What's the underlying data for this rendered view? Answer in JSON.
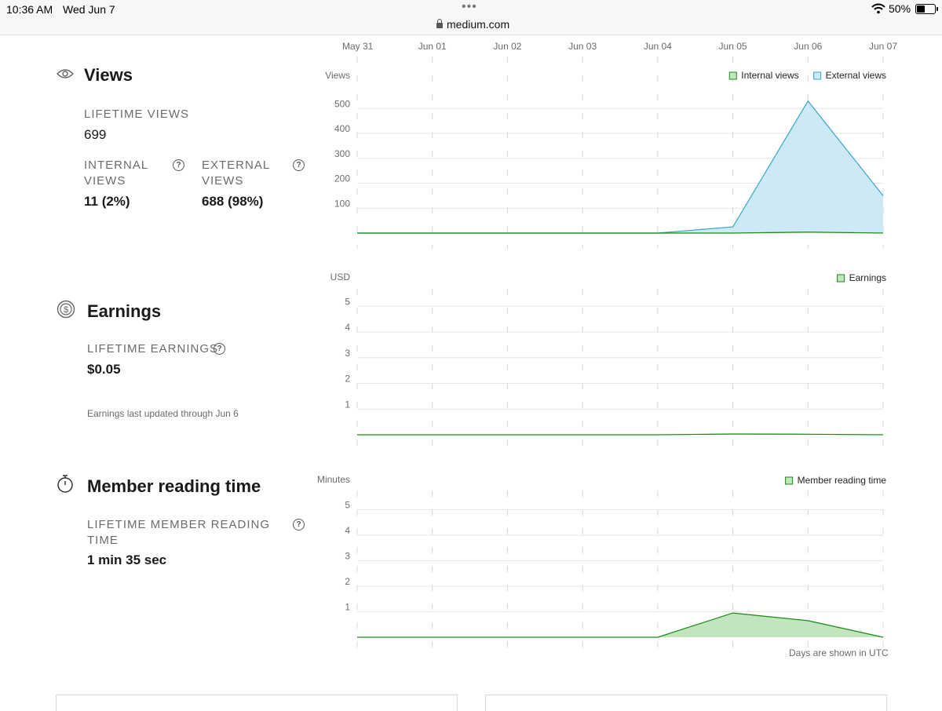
{
  "status_bar": {
    "time": "10:36 AM",
    "date": "Wed Jun 7",
    "url": "medium.com",
    "battery": "50%",
    "battery_level": 0.5
  },
  "views": {
    "title": "Views",
    "lifetime_label": "LIFETIME VIEWS",
    "lifetime_value": "699",
    "internal_label_1": "INTERNAL",
    "internal_label_2": "VIEWS",
    "internal_value": "11 (2%)",
    "external_label_1": "EXTERNAL",
    "external_label_2": "VIEWS",
    "external_value": "688 (98%)"
  },
  "earnings": {
    "title": "Earnings",
    "lifetime_label": "LIFETIME EARNINGS",
    "lifetime_value": "$0.05",
    "note": "Earnings last updated through Jun 6"
  },
  "reading": {
    "title": "Member reading time",
    "lifetime_label_1": "LIFETIME MEMBER READING",
    "lifetime_label_2": "TIME",
    "lifetime_value": "1 min 35 sec"
  },
  "icons": {
    "views": "eye-icon",
    "earnings": "dollar-coin-icon",
    "reading": "stopwatch-icon",
    "help": "question-circle-icon"
  },
  "help_glyph": "?",
  "footer_note": "Days are shown in UTC",
  "colors": {
    "green": "#1a8917",
    "green_fill": "#c2e4be",
    "blue": "#3ba6c8",
    "blue_fill": "#cde9f5",
    "grid": "#e6e6e6"
  },
  "chart_data": [
    {
      "type": "area",
      "ylabel": "Views",
      "x": [
        "May 31",
        "Jun 01",
        "Jun 02",
        "Jun 03",
        "Jun 04",
        "Jun 05",
        "Jun 06",
        "Jun 07"
      ],
      "yticks": [
        100,
        200,
        300,
        400,
        500
      ],
      "ylim": [
        0,
        550
      ],
      "legend_position": "top-right",
      "series": [
        {
          "name": "Internal views",
          "values": [
            0,
            0,
            0,
            0,
            0,
            0,
            4,
            0
          ],
          "color": "#1a8917",
          "fill": "#c2e4be"
        },
        {
          "name": "External views",
          "values": [
            0,
            0,
            0,
            0,
            0,
            25,
            530,
            150
          ],
          "color": "#3ba6c8",
          "fill": "#cde9f5"
        }
      ]
    },
    {
      "type": "area",
      "ylabel": "USD",
      "x": [
        "May 31",
        "Jun 01",
        "Jun 02",
        "Jun 03",
        "Jun 04",
        "Jun 05",
        "Jun 06",
        "Jun 07"
      ],
      "yticks": [
        1,
        2,
        3,
        4,
        5
      ],
      "ylim": [
        0,
        5
      ],
      "legend_position": "top-right",
      "series": [
        {
          "name": "Earnings",
          "values": [
            0,
            0,
            0,
            0,
            0,
            0.03,
            0.02,
            0
          ],
          "color": "#1a8917",
          "fill": "#c2e4be"
        }
      ]
    },
    {
      "type": "area",
      "ylabel": "Minutes",
      "x": [
        "May 31",
        "Jun 01",
        "Jun 02",
        "Jun 03",
        "Jun 04",
        "Jun 05",
        "Jun 06",
        "Jun 07"
      ],
      "yticks": [
        1,
        2,
        3,
        4,
        5
      ],
      "ylim": [
        0,
        5
      ],
      "legend_position": "top-right",
      "series": [
        {
          "name": "Member reading time",
          "values": [
            0,
            0,
            0,
            0,
            0,
            0.95,
            0.65,
            0
          ],
          "color": "#1a8917",
          "fill": "#c2e4be"
        }
      ]
    }
  ]
}
